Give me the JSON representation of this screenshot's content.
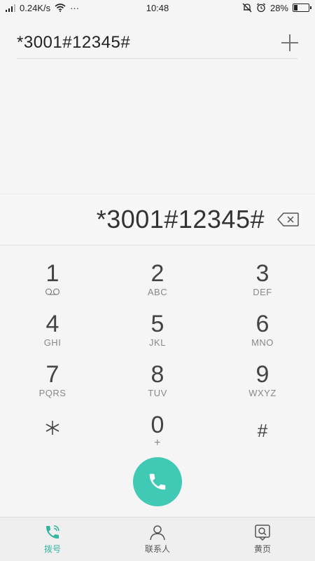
{
  "status_bar": {
    "network_speed": "0.24K/s",
    "dots": "···",
    "time": "10:48",
    "battery_percent": "28%",
    "battery_level": 0.28
  },
  "top": {
    "number": "*3001#12345#",
    "add_icon": "plus-icon"
  },
  "input": {
    "value": "*3001#12345#",
    "backspace_icon": "backspace-icon"
  },
  "keypad": [
    {
      "digit": "1",
      "letters": ""
    },
    {
      "digit": "2",
      "letters": "ABC"
    },
    {
      "digit": "3",
      "letters": "DEF"
    },
    {
      "digit": "4",
      "letters": "GHI"
    },
    {
      "digit": "5",
      "letters": "JKL"
    },
    {
      "digit": "6",
      "letters": "MNO"
    },
    {
      "digit": "7",
      "letters": "PQRS"
    },
    {
      "digit": "8",
      "letters": "TUV"
    },
    {
      "digit": "9",
      "letters": "WXYZ"
    },
    {
      "digit": "*",
      "letters": ""
    },
    {
      "digit": "0",
      "letters": "+"
    },
    {
      "digit": "#",
      "letters": ""
    }
  ],
  "call_button_color": "#40c9b4",
  "nav": {
    "dial": "拨号",
    "contacts": "联系人",
    "yellow_pages": "黄页",
    "active_color": "#33b5a0"
  }
}
